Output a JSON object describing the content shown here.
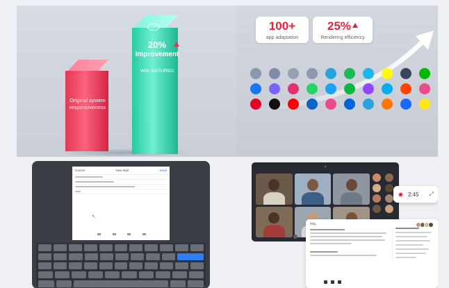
{
  "performance": {
    "bar_original_label": "Original system responsiveness",
    "bar_improved_percent": "20%",
    "bar_improved_label": "Improvement",
    "bar_improved_sub": "With SIXTURBO",
    "accent_colors": {
      "red": "#e4304f",
      "green": "#1ec9a0"
    }
  },
  "stats": [
    {
      "value": "100+",
      "caption": "app adaptation"
    },
    {
      "value": "25%",
      "caption": "Rendering efficiency"
    }
  ],
  "apps": {
    "rows": [
      [
        {
          "icon": "app-icon-1",
          "color": "#8a96b0"
        },
        {
          "icon": "app-icon-2",
          "color": "#7f8ca8"
        },
        {
          "icon": "app-icon-3",
          "color": "#97a0b6"
        },
        {
          "icon": "app-icon-4",
          "color": "#8d98af"
        },
        {
          "icon": "telegram-icon",
          "color": "#2aa3dd"
        },
        {
          "icon": "spotify-icon",
          "color": "#1db954"
        },
        {
          "icon": "vimeo-icon",
          "color": "#1ab7ea"
        },
        {
          "icon": "snapchat-icon",
          "color": "#fffc00"
        },
        {
          "icon": "tumblr-icon",
          "color": "#36465d"
        },
        {
          "icon": "line-icon",
          "color": "#00b900"
        }
      ],
      [
        {
          "icon": "facebook-icon",
          "color": "#1877f2"
        },
        {
          "icon": "messenger-icon",
          "color": "#7b61ff"
        },
        {
          "icon": "instagram-icon",
          "color": "#e1306c"
        },
        {
          "icon": "whatsapp-icon",
          "color": "#25d366"
        },
        {
          "icon": "twitter-icon",
          "color": "#1da1f2"
        },
        {
          "icon": "wechat-icon",
          "color": "#09b83e"
        },
        {
          "icon": "twitch-icon",
          "color": "#9146ff"
        },
        {
          "icon": "skype-icon",
          "color": "#00aff0"
        },
        {
          "icon": "reddit-icon",
          "color": "#ff4500"
        },
        {
          "icon": "dribbble-icon",
          "color": "#ea4c89"
        }
      ],
      [
        {
          "icon": "pinterest-icon",
          "color": "#e60023"
        },
        {
          "icon": "tiktok-icon",
          "color": "#111111"
        },
        {
          "icon": "youtube-icon",
          "color": "#ff0000"
        },
        {
          "icon": "linkedin-icon",
          "color": "#0a66c2"
        },
        {
          "icon": "dribbble-icon",
          "color": "#ea4c89"
        },
        {
          "icon": "flickr-icon",
          "color": "#0063dc"
        },
        {
          "icon": "telegram-icon",
          "color": "#2aa3dd"
        },
        {
          "icon": "soundcloud-icon",
          "color": "#ff7700"
        },
        {
          "icon": "behance-icon",
          "color": "#1769ff"
        },
        {
          "icon": "kakaotalk-icon",
          "color": "#ffe812"
        }
      ]
    ]
  },
  "tablet": {
    "header_left": "Cancel",
    "header_title": "New Mail",
    "header_right": "Send"
  },
  "meeting": {
    "recording_time": "2:45",
    "notes_brand": "TCL"
  }
}
